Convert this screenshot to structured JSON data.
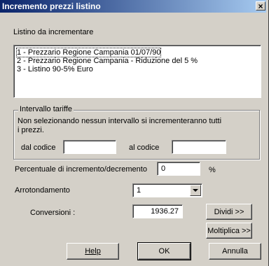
{
  "window": {
    "title": "Incremento prezzi listino",
    "close_glyph": "×"
  },
  "listino": {
    "label": "Listino da incrementare",
    "items": [
      {
        "label": "1 - Prezzario Regione Campania 01/07/90",
        "selected": true
      },
      {
        "label": "2 - Prezzario Regione Campania - Riduzione del 5 %",
        "selected": false
      },
      {
        "label": "3 - Listino 90-5% Euro",
        "selected": false
      }
    ]
  },
  "intervallo": {
    "title": "Intervallo tariffe",
    "note_line1": "Non selezionando nessun intervallo si incrementeranno tutti",
    "note_line2": "i prezzi.",
    "dal_label": "dal codice",
    "dal_value": "",
    "al_label": "al codice",
    "al_value": ""
  },
  "percentuale": {
    "label": "Percentuale di incremento/decremento",
    "value": "0",
    "unit": "%"
  },
  "arrotondamento": {
    "label": "Arrotondamento",
    "value": "1"
  },
  "conversioni": {
    "label": "Conversioni :",
    "value": "1936.27",
    "dividi_label": "Dividi >>",
    "moltiplica_label": "Moltiplica >>"
  },
  "buttons": {
    "help_label": "Help",
    "ok_label": "OK",
    "annulla_label": "Annulla"
  }
}
